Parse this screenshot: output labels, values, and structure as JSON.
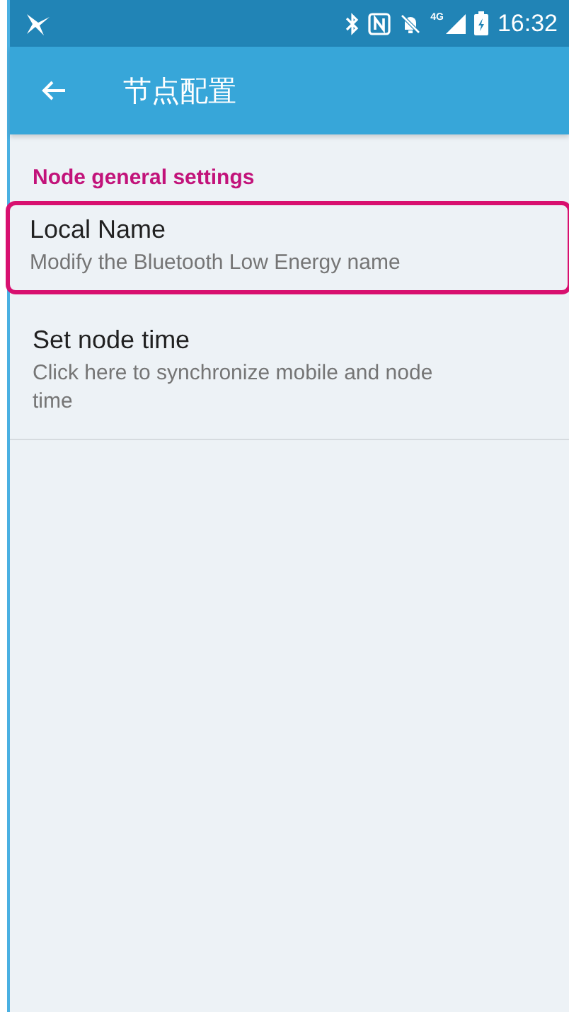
{
  "status_bar": {
    "network": "4G",
    "time": "16:32"
  },
  "app_bar": {
    "title": "节点配置"
  },
  "section": {
    "title": "Node general settings"
  },
  "items": [
    {
      "title": "Local Name",
      "summary": "Modify the Bluetooth Low Energy name",
      "highlighted": true
    },
    {
      "title": "Set node time",
      "summary": "Click here to synchronize mobile and node time",
      "highlighted": false
    }
  ]
}
